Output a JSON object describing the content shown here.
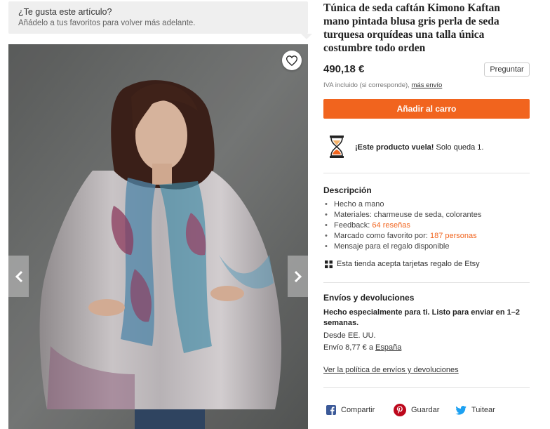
{
  "favorite_tip": {
    "question": "¿Te gusta este artículo?",
    "hint": "Añádelo a tus favoritos para volver más adelante."
  },
  "gallery": {
    "favorite_icon": "heart-icon",
    "prev_icon": "chevron-left-icon",
    "next_icon": "chevron-right-icon"
  },
  "product": {
    "title": "Túnica de seda caftán Kimono Kaftan mano pintada blusa gris perla de seda turquesa orquídeas una talla única costumbre todo orden",
    "price": "490,18 €",
    "ask_label": "Preguntar",
    "vat_text": "IVA incluido (si corresponde),",
    "vat_link": "más envío",
    "add_to_cart": "Añadir al carro"
  },
  "scarcity": {
    "icon": "hourglass-icon",
    "bold": "¡Este producto vuela!",
    "rest": " Solo queda 1."
  },
  "description": {
    "heading": "Descripción",
    "item_handmade": "Hecho a mano",
    "item_materials": "Materiales: charmeuse de seda, colorantes",
    "feedback_label": "Feedback: ",
    "feedback_link": "64 reseñas",
    "favorited_label": "Marcado como favorito por: ",
    "favorited_link": "187 personas",
    "item_gift_msg": "Mensaje para el regalo disponible",
    "gift_cards": "Esta tienda acepta tarjetas regalo de Etsy",
    "gift_icon": "gift-card-icon"
  },
  "shipping": {
    "heading": "Envíos y devoluciones",
    "made_for_you": "Hecho especialmente para ti. Listo para enviar en 1–2 semanas.",
    "from": "Desde EE. UU.",
    "cost_prefix": "Envío 8,77 € a ",
    "cost_dest": "España",
    "policy_link": "Ver la política de envíos y devoluciones"
  },
  "share": {
    "facebook": "Compartir",
    "pinterest": "Guardar",
    "twitter": "Tuitear"
  },
  "colors": {
    "accent": "#f1641e",
    "facebook": "#3b5998",
    "pinterest": "#bd081c",
    "twitter": "#1da1f2"
  }
}
